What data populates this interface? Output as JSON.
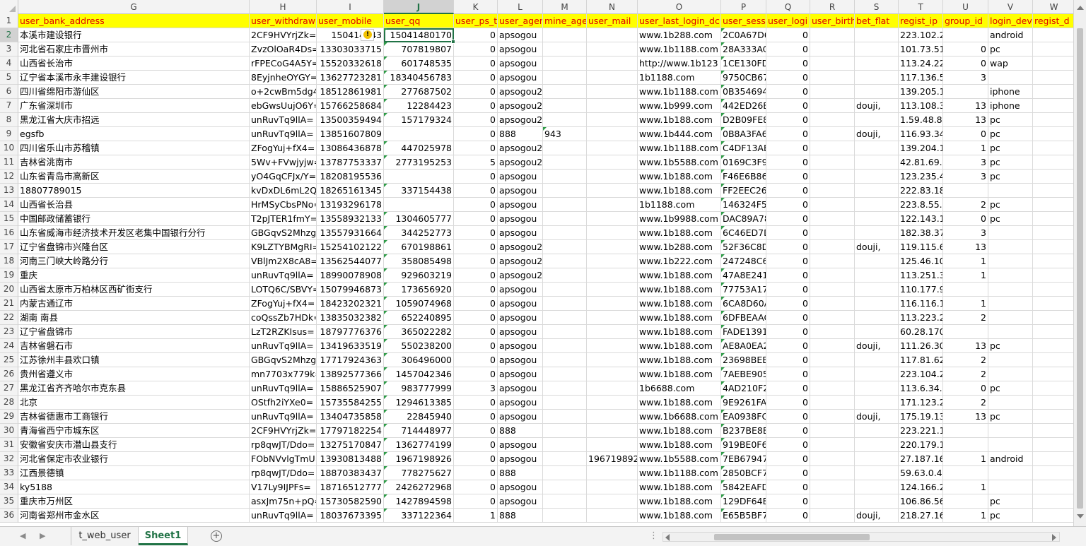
{
  "columns": [
    "G",
    "H",
    "I",
    "J",
    "K",
    "L",
    "M",
    "N",
    "O",
    "P",
    "Q",
    "R",
    "S",
    "T",
    "U",
    "V",
    "W"
  ],
  "selected_column": "J",
  "selected_row": 2,
  "header_row_number": "1",
  "headers": [
    "user_bank_address",
    "user_withdraw",
    "user_mobile",
    "user_qq",
    "user_ps_t",
    "user_ager",
    "mine_age",
    "user_mail",
    "user_last_login_dc",
    "user_sess",
    "user_logi",
    "user_birth",
    "bet_flat",
    "regist_ip",
    "group_id",
    "login_dev",
    "regist_d"
  ],
  "rows": [
    {
      "n": "2",
      "c": [
        "本溪市建设银行",
        "2CF9HVYrjZk=",
        "150414443",
        "15041480170",
        "0",
        "apsogou",
        "",
        "",
        "www.1b288.com",
        "2C0A67D6",
        "0",
        "",
        "",
        "223.102.216.246",
        "",
        "android",
        ""
      ]
    },
    {
      "n": "3",
      "c": [
        "河北省石家庄市晋州市",
        "ZvzOlOaR4Ds=",
        "13303033715",
        "707819807",
        "0",
        "apsogou",
        "",
        "",
        "www.1b1188.com",
        "28A333AC",
        "0",
        "",
        "",
        "101.73.51.",
        "0",
        "pc",
        ""
      ]
    },
    {
      "n": "4",
      "c": [
        "山西省长治市",
        "rFPECoG4A5Y=",
        "15520332618",
        "601748535",
        "0",
        "apsogou",
        "",
        "",
        "http://www.1b123",
        "1CE130FD",
        "0",
        "",
        "",
        "113.24.22(",
        "0",
        "wap",
        ""
      ]
    },
    {
      "n": "5",
      "c": [
        "辽宁省本溪市永丰建设银行",
        "8EyjnheOYGY=",
        "13627723281",
        "18340456783",
        "0",
        "apsogou",
        "",
        "",
        "1b1188.com",
        "9750CB67",
        "0",
        "",
        "",
        "117.136.5.",
        "3",
        "",
        ""
      ]
    },
    {
      "n": "6",
      "c": [
        "四川省绵阳市游仙区",
        "o+2cwBm5dg4=",
        "18512861981",
        "277687502",
        "0",
        "apsogou2",
        "",
        "",
        "www.1b1188.com",
        "0B354694.",
        "0",
        "",
        "",
        "139.205.138.81",
        "",
        "iphone",
        ""
      ]
    },
    {
      "n": "7",
      "c": [
        "广东省深圳市",
        "ebGwsUujO6Y=",
        "15766258684",
        "12284423",
        "0",
        "apsogou2",
        "",
        "",
        "www.1b999.com",
        "442ED26E",
        "0",
        "",
        "douji,",
        "113.108.3!",
        "13",
        "iphone",
        ""
      ]
    },
    {
      "n": "8",
      "c": [
        "黑龙江省大庆市招远",
        "unRuvTq9llA=",
        "13500359494",
        "157179324",
        "0",
        "apsogou2",
        "",
        "",
        "www.1b188.com",
        "D2B09FE8",
        "0",
        "",
        "",
        "1.59.48.80",
        "13",
        "pc",
        ""
      ]
    },
    {
      "n": "9",
      "c": [
        "egsfb",
        "unRuvTq9llA=",
        "13851607809",
        "",
        "0",
        "888",
        "943",
        "",
        "www.1b444.com",
        "0B8A3FA6",
        "0",
        "",
        "douji,",
        "116.93.34.",
        "0",
        "pc",
        ""
      ]
    },
    {
      "n": "10",
      "c": [
        "四川省乐山市苏稽镇",
        "ZFogYuj+fX4=",
        "13086436878",
        "447025978",
        "0",
        "apsogou2",
        "",
        "",
        "www.1b1188.com",
        "C4DF13AE",
        "0",
        "",
        "",
        "139.204.1!",
        "1",
        "pc",
        ""
      ]
    },
    {
      "n": "11",
      "c": [
        "吉林省洮南市",
        "5Wv+FVwjyjw=",
        "13787753337",
        "2773195253",
        "5",
        "apsogou2",
        "",
        "",
        "www.1b5588.com",
        "0169C3F9",
        "0",
        "",
        "",
        "42.81.69.1",
        "3",
        "pc",
        ""
      ]
    },
    {
      "n": "12",
      "c": [
        "山东省青岛市高新区",
        "yO4GqCFJx/Y=",
        "18208195536",
        "",
        "0",
        "apsogou",
        "",
        "",
        "www.1b188.com",
        "F46E6B86",
        "0",
        "",
        "",
        "123.235.4.",
        "3",
        "pc",
        ""
      ]
    },
    {
      "n": "13",
      "c": [
        "18807789015",
        "kvDxDL6mL2Q=",
        "18265161345",
        "337154438",
        "0",
        "apsogou",
        "",
        "",
        "www.1b188.com",
        "FF2EEC26",
        "0",
        "",
        "",
        "222.83.186.238",
        "",
        "",
        ""
      ]
    },
    {
      "n": "14",
      "c": [
        "山西省长治县",
        "HrMSyCbsPNo=",
        "13193296178",
        "",
        "0",
        "apsogou",
        "",
        "",
        "1b1188.com",
        "146324F5",
        "0",
        "",
        "",
        "223.8.55.2",
        "2",
        "pc",
        ""
      ]
    },
    {
      "n": "15",
      "c": [
        "中国邮政储蓄银行",
        "T2pJTER1fmY=",
        "13558932133",
        "1304605777",
        "0",
        "apsogou",
        "",
        "",
        "www.1b9988.com",
        "DAC89A78",
        "0",
        "",
        "",
        "122.143.1!",
        "0",
        "pc",
        ""
      ]
    },
    {
      "n": "16",
      "c": [
        "山东省威海市经济技术开发区老集中国银行分行",
        "GBGqvS2Mhzg=",
        "13557931664",
        "344252773",
        "0",
        "apsogou",
        "",
        "",
        "www.1b188.com",
        "6C46ED7D",
        "0",
        "",
        "",
        "182.38.37.",
        "3",
        "",
        ""
      ]
    },
    {
      "n": "17",
      "c": [
        "辽宁省盘锦市兴隆台区",
        "K9LZTYBMgRI=",
        "15254102122",
        "670198861",
        "0",
        "apsogou2",
        "",
        "",
        "www.1b288.com",
        "52F36C8D",
        "0",
        "",
        "douji,",
        "119.115.6-",
        "13",
        "",
        ""
      ]
    },
    {
      "n": "18",
      "c": [
        "河南三门峡大岭路分行",
        "VBlJm2X8cA8=",
        "13562544077",
        "358085498",
        "0",
        "apsogou2",
        "",
        "",
        "www.1b222.com",
        "247248C6",
        "0",
        "",
        "",
        "125.46.103",
        "1",
        "",
        ""
      ]
    },
    {
      "n": "19",
      "c": [
        "重庆",
        "unRuvTq9llA=",
        "18990078908",
        "929603219",
        "0",
        "apsogou2",
        "",
        "",
        "www.1b188.com",
        "47A8E241",
        "0",
        "",
        "",
        "113.251.3(",
        "1",
        "",
        ""
      ]
    },
    {
      "n": "20",
      "c": [
        "山西省太原市万柏林区西矿街支行",
        "LOTQ6C/SBVY=",
        "15079946873",
        "173656920",
        "0",
        "apsogou",
        "",
        "",
        "www.1b188.com",
        "77753A17",
        "0",
        "",
        "",
        "110.177.99.132",
        "",
        "",
        ""
      ]
    },
    {
      "n": "21",
      "c": [
        "内蒙古通辽市",
        "ZFogYuj+fX4=",
        "18423202321",
        "1059074968",
        "0",
        "apsogou",
        "",
        "",
        "www.1b188.com",
        "6CA8D60A",
        "0",
        "",
        "",
        "116.116.1-",
        "1",
        "",
        ""
      ]
    },
    {
      "n": "22",
      "c": [
        "湖南 南县",
        "coQssZb7HDk=",
        "13835032382",
        "652240895",
        "0",
        "apsogou",
        "",
        "",
        "www.1b188.com",
        "6DFBEAAC",
        "0",
        "",
        "",
        "113.223.2:",
        "2",
        "",
        ""
      ]
    },
    {
      "n": "23",
      "c": [
        "辽宁省盘锦市",
        "LzT2RZKIsus=",
        "18797776376",
        "365022282",
        "0",
        "apsogou",
        "",
        "",
        "www.1b188.com",
        "FADE1391",
        "0",
        "",
        "",
        "60.28.170.22",
        "",
        "",
        ""
      ]
    },
    {
      "n": "24",
      "c": [
        "吉林省磐石市",
        "unRuvTq9llA=",
        "13419633519",
        "550238200",
        "0",
        "apsogou",
        "",
        "",
        "www.1b188.com",
        "AE8A0EA2",
        "0",
        "",
        "douji,",
        "111.26.30.",
        "13",
        "pc",
        ""
      ]
    },
    {
      "n": "25",
      "c": [
        "江苏徐州丰县欢口镇",
        "GBGqvS2Mhzg=",
        "17717924363",
        "306496000",
        "0",
        "apsogou",
        "",
        "",
        "www.1b188.com",
        "23698BEE",
        "0",
        "",
        "",
        "117.81.62.",
        "2",
        "",
        ""
      ]
    },
    {
      "n": "26",
      "c": [
        "贵州省遵义市",
        "mn7703x779k=",
        "13892577366",
        "1457042346",
        "0",
        "apsogou",
        "",
        "",
        "www.1b188.com",
        "7AEBE905",
        "0",
        "",
        "",
        "223.104.2-",
        "2",
        "",
        ""
      ]
    },
    {
      "n": "27",
      "c": [
        "黑龙江省齐齐哈尔市克东县",
        "unRuvTq9llA=",
        "15886525907",
        "983777999",
        "3",
        "apsogou",
        "",
        "",
        "1b6688.com",
        "4AD210F2",
        "0",
        "",
        "",
        "113.6.34.7",
        "0",
        "pc",
        ""
      ]
    },
    {
      "n": "28",
      "c": [
        "北京",
        "OStfh2iYXe0=",
        "15735584255",
        "1294613385",
        "0",
        "apsogou",
        "",
        "",
        "www.1b188.com",
        "9E9261FA",
        "0",
        "",
        "",
        "171.123.2-",
        "2",
        "",
        ""
      ]
    },
    {
      "n": "29",
      "c": [
        "吉林省德惠市工商银行",
        "unRuvTq9llA=",
        "13404735858",
        "22845940",
        "0",
        "apsogou",
        "",
        "",
        "www.1b6688.com",
        "EA0938FC",
        "0",
        "",
        "douji,",
        "175.19.13(",
        "13",
        "pc",
        ""
      ]
    },
    {
      "n": "30",
      "c": [
        "青海省西宁市城东区",
        "2CF9HVYrjZk=",
        "17797182254",
        "714448977",
        "0",
        "888",
        "",
        "",
        "www.1b188.com",
        "B237BE8B",
        "0",
        "",
        "",
        "223.221.161.149",
        "",
        "",
        ""
      ]
    },
    {
      "n": "31",
      "c": [
        "安徽省安庆市潜山县支行",
        "rp8qwJT/Ddo=",
        "13275170847",
        "1362774199",
        "0",
        "apsogou",
        "",
        "",
        "www.1b188.com",
        "919BE0F6",
        "0",
        "",
        "",
        "220.179.18.166",
        "",
        "",
        ""
      ]
    },
    {
      "n": "32",
      "c": [
        "河北省保定市农业银行",
        "FObNVvlgTmU=",
        "13930813488",
        "1967198926",
        "0",
        "apsogou",
        "",
        "1967198926",
        "www.1b5588.com",
        "7EB67947",
        "0",
        "",
        "",
        "27.187.16:",
        "1",
        "android",
        ""
      ]
    },
    {
      "n": "33",
      "c": [
        "江西景德镇",
        "rp8qwJT/Ddo=",
        "18870383437",
        "778275627",
        "0",
        "888",
        "",
        "",
        "www.1b1188.com",
        "2850BCF7",
        "0",
        "",
        "",
        "59.63.0.41",
        "",
        "",
        ""
      ]
    },
    {
      "n": "34",
      "c": [
        "ky5188",
        "V17Ly9IJPFs=",
        "18716512777",
        "2426272968",
        "0",
        "apsogou",
        "",
        "",
        "www.1b188.com",
        "5842EAFD",
        "0",
        "",
        "",
        "124.166.2:",
        "1",
        "",
        ""
      ]
    },
    {
      "n": "35",
      "c": [
        "重庆市万州区",
        "asxJm75n+pQ=",
        "15730582590",
        "1427894598",
        "0",
        "apsogou",
        "",
        "",
        "www.1b188.com",
        "129DF64E",
        "0",
        "",
        "",
        "106.86.56.16",
        "",
        "pc",
        ""
      ]
    },
    {
      "n": "36",
      "c": [
        "河南省郑州市金水区",
        "unRuvTq9llA=",
        "18037673395",
        "337122364",
        "1",
        "888",
        "",
        "",
        "www.1b188.com",
        "E65B5BF7",
        "0",
        "",
        "douji,",
        "218.27.16:",
        "1",
        "pc",
        ""
      ]
    }
  ],
  "tabs": [
    "t_web_user",
    "Sheet1"
  ],
  "active_tab": "Sheet1",
  "add_sheet_symbol": "+",
  "more_symbol": "⋮",
  "colors": {
    "header_fill": "#ffff00",
    "header_text": "#e00000",
    "accent": "#217346"
  }
}
